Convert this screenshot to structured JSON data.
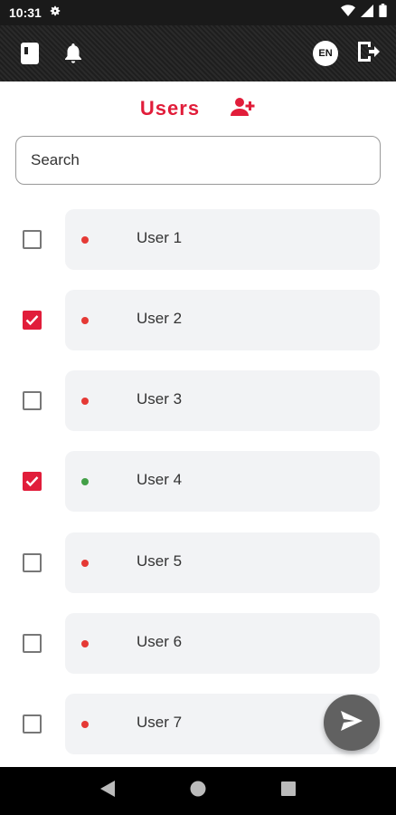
{
  "status_bar": {
    "time": "10:31",
    "icons": [
      "gear-icon",
      "wifi-icon",
      "signal-icon",
      "battery-icon"
    ]
  },
  "app_bar": {
    "left_icons": [
      "book-icon",
      "bell-icon"
    ],
    "language": "EN",
    "right_icons": [
      "logout-icon"
    ]
  },
  "header": {
    "title": "Users",
    "add_icon": "add-user-icon"
  },
  "search": {
    "placeholder": "Search",
    "value": ""
  },
  "users": [
    {
      "name": "User 1",
      "checked": false,
      "status": "offline"
    },
    {
      "name": "User 2",
      "checked": true,
      "status": "offline"
    },
    {
      "name": "User 3",
      "checked": false,
      "status": "offline"
    },
    {
      "name": "User 4",
      "checked": true,
      "status": "online"
    },
    {
      "name": "User 5",
      "checked": false,
      "status": "offline"
    },
    {
      "name": "User 6",
      "checked": false,
      "status": "offline"
    },
    {
      "name": "User 7",
      "checked": false,
      "status": "offline"
    }
  ],
  "colors": {
    "accent": "#e11d3a",
    "online": "#43a047",
    "offline": "#e53935",
    "card": "#f2f3f5",
    "fab": "#616161"
  },
  "fab": {
    "icon": "send-icon"
  },
  "nav_bar": {
    "icons": [
      "back-icon",
      "home-icon",
      "recents-icon"
    ]
  }
}
